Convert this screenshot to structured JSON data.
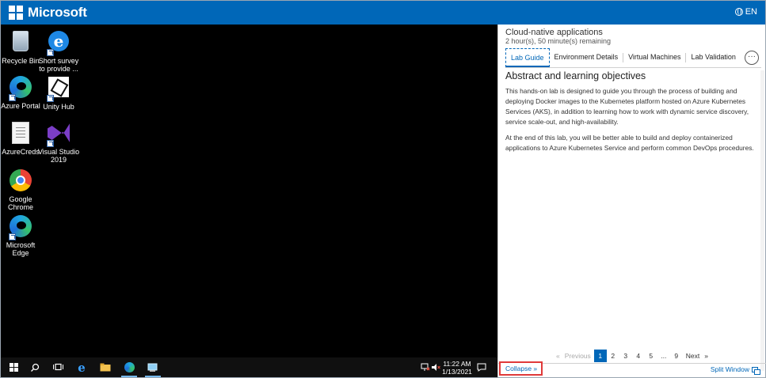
{
  "header": {
    "brand": "Microsoft",
    "language": "EN",
    "bg_color": "#0067b8"
  },
  "desktop": {
    "icons": [
      {
        "label": "Recycle Bin",
        "icon": "recycle-bin-icon"
      },
      {
        "label": "Short survey to provide ...",
        "icon": "ie-shortcut-icon"
      },
      {
        "label": "Azure Portal",
        "icon": "edge-shortcut-icon"
      },
      {
        "label": "Unity Hub",
        "icon": "unity-icon"
      },
      {
        "label": "AzureCreds",
        "icon": "text-file-icon"
      },
      {
        "label": "Visual Studio 2019",
        "icon": "visual-studio-icon"
      },
      {
        "label": "Google Chrome",
        "icon": "chrome-icon"
      },
      {
        "label": "Microsoft Edge",
        "icon": "edge-icon"
      }
    ]
  },
  "taskbar": {
    "time": "11:22 AM",
    "date": "1/13/2021"
  },
  "panel": {
    "lab_title": "Cloud-native applications",
    "remaining": "2 hour(s), 50 minute(s) remaining",
    "tabs": [
      "Lab Guide",
      "Environment Details",
      "Virtual Machines",
      "Lab Validation"
    ],
    "active_tab": "Lab Guide",
    "more_label": "···",
    "heading": "Abstract and learning objectives",
    "paragraphs": [
      "This hands-on lab is designed to guide you through the process of building and deploying Docker images to the Kubernetes platform hosted on Azure Kubernetes Services (AKS), in addition to learning how to work with dynamic service discovery, service scale-out, and high-availability.",
      "At the end of this lab, you will be better able to build and deploy containerized applications to Azure Kubernetes Service and perform common DevOps procedures."
    ],
    "pagination": {
      "first": "«",
      "previous": "Previous",
      "pages": [
        "1",
        "2",
        "3",
        "4",
        "5",
        "...",
        "9"
      ],
      "current": "1",
      "next": "Next",
      "last": "»"
    },
    "collapse_label": "Collapse »",
    "split_window_label": "Split Window"
  }
}
